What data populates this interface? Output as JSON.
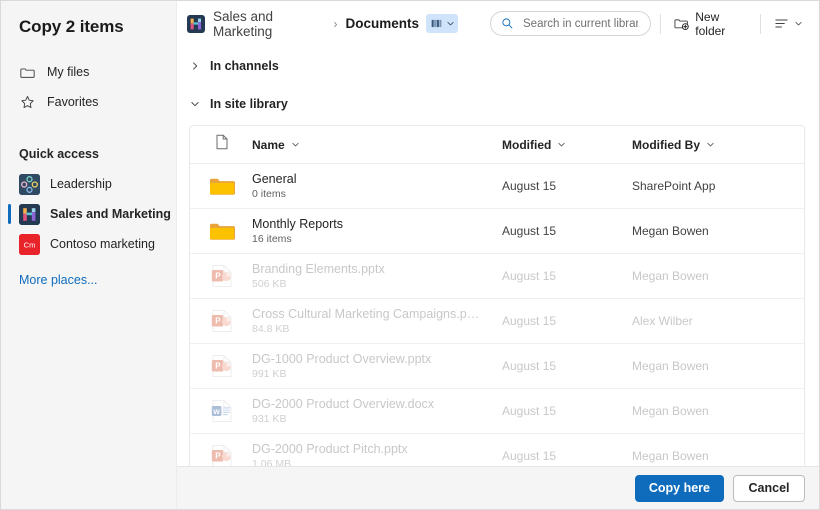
{
  "dialog": {
    "title": "Copy 2 items"
  },
  "sidebar": {
    "nav": [
      {
        "label": "My files",
        "icon": "folder-outline-icon"
      },
      {
        "label": "Favorites",
        "icon": "star-outline-icon"
      }
    ],
    "quick_access_heading": "Quick access",
    "quick_access": [
      {
        "label": "Leadership",
        "icon": "leadership-team-icon",
        "selected": false
      },
      {
        "label": "Sales and Marketing",
        "icon": "sales-marketing-team-icon",
        "selected": true
      },
      {
        "label": "Contoso marketing",
        "icon": "contoso-marketing-team-icon",
        "selected": false
      }
    ],
    "more_places": "More places..."
  },
  "commandbar": {
    "breadcrumb_site": "Sales and Marketing",
    "breadcrumb_separator": "›",
    "breadcrumb_current": "Documents",
    "library_badge_icon": "library-books-icon",
    "library_badge_chevron": "chevron-down-icon",
    "search": {
      "placeholder": "Search in current library",
      "value": "",
      "icon": "search-icon"
    },
    "new_folder": {
      "label": "New folder",
      "icon": "new-folder-icon"
    },
    "view_options": {
      "icon": "list-view-icon",
      "chevron": "chevron-down-icon"
    }
  },
  "sections": {
    "channels": {
      "label": "In channels",
      "expanded": false,
      "chevron": "chevron-right-icon"
    },
    "site_library": {
      "label": "In site library",
      "expanded": true,
      "chevron": "chevron-down-icon"
    }
  },
  "table": {
    "columns": {
      "icon": "file-type-icon",
      "name": "Name",
      "modified": "Modified",
      "modified_by": "Modified By",
      "sort_chevron": "chevron-down-icon"
    },
    "rows": [
      {
        "icon": "folder-icon",
        "name": "General",
        "sub": "0 items",
        "modified": "August 15",
        "modified_by": "SharePoint App",
        "disabled": false
      },
      {
        "icon": "folder-icon",
        "name": "Monthly Reports",
        "sub": "16 items",
        "modified": "August 15",
        "modified_by": "Megan Bowen",
        "disabled": false
      },
      {
        "icon": "powerpoint-icon",
        "name": "Branding Elements.pptx",
        "sub": "506 KB",
        "modified": "August 15",
        "modified_by": "Megan Bowen",
        "disabled": true
      },
      {
        "icon": "powerpoint-icon",
        "name": "Cross Cultural Marketing Campaigns.p…",
        "sub": "84.8 KB",
        "modified": "August 15",
        "modified_by": "Alex Wilber",
        "disabled": true
      },
      {
        "icon": "powerpoint-icon",
        "name": "DG-1000 Product Overview.pptx",
        "sub": "991 KB",
        "modified": "August 15",
        "modified_by": "Megan Bowen",
        "disabled": true
      },
      {
        "icon": "word-icon",
        "name": "DG-2000 Product Overview.docx",
        "sub": "931 KB",
        "modified": "August 15",
        "modified_by": "Megan Bowen",
        "disabled": true
      },
      {
        "icon": "powerpoint-icon",
        "name": "DG-2000 Product Pitch.pptx",
        "sub": "1.06 MB",
        "modified": "August 15",
        "modified_by": "Megan Bowen",
        "disabled": true
      }
    ]
  },
  "footer": {
    "primary": "Copy here",
    "secondary": "Cancel"
  },
  "colors": {
    "accent": "#0f6cbd",
    "sidebar_bg": "#f5f6f6",
    "folder": "#fcc200",
    "powerpoint": "#d35230",
    "word": "#2b579a",
    "library_badge": "#cfe4fa",
    "link": "#0f6cbd"
  }
}
